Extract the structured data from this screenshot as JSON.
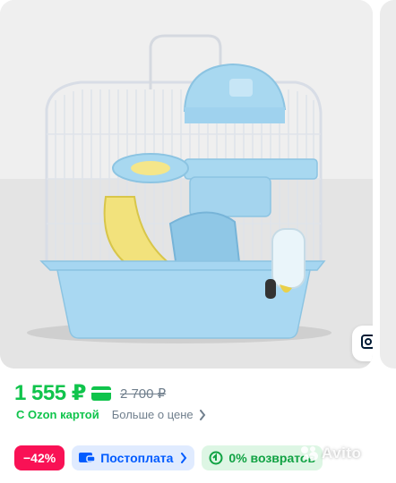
{
  "product": {
    "price": "1 555 ₽",
    "old_price": "2 700 ₽",
    "ozon_card_label": "С Ozon картой",
    "more_price_label": "Больше о цене"
  },
  "tags": {
    "discount": "−42%",
    "postpay": "Постоплата",
    "returns": "0% возвратов"
  },
  "watermark": "Avito",
  "icons": {
    "card": "ozon-card-icon",
    "lens": "image-search-icon",
    "postpay": "wallet-card-icon",
    "returns": "return-arrow-icon"
  },
  "colors": {
    "price_green": "#10c44c",
    "discount_pink": "#f91155",
    "postpay_blue": "#005bff",
    "returns_green": "#10a243"
  }
}
